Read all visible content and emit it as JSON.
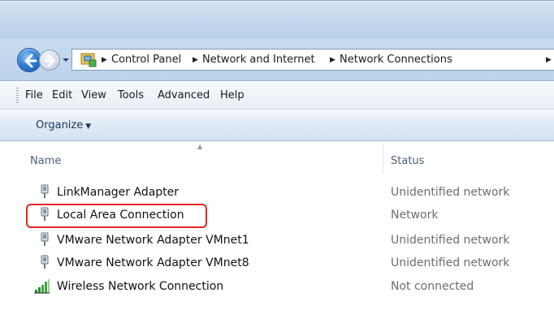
{
  "address_bar": {
    "breadcrumbs": [
      "Control Panel",
      "Network and Internet",
      "Network Connections"
    ]
  },
  "menu": {
    "items": [
      "File",
      "Edit",
      "View",
      "Tools",
      "Advanced",
      "Help"
    ]
  },
  "command_bar": {
    "organize_label": "Organize"
  },
  "columns": {
    "name": "Name",
    "status": "Status"
  },
  "connections": [
    {
      "name": "LinkManager Adapter",
      "status": "Unidentified network",
      "icon": "network-adapter-icon"
    },
    {
      "name": "Local Area Connection",
      "status": "Network",
      "icon": "network-adapter-icon",
      "highlighted": true
    },
    {
      "name": "VMware Network Adapter VMnet1",
      "status": "Unidentified network",
      "icon": "network-adapter-icon"
    },
    {
      "name": "VMware Network Adapter VMnet8",
      "status": "Unidentified network",
      "icon": "network-adapter-icon"
    },
    {
      "name": "Wireless Network Connection",
      "status": "Not connected",
      "icon": "wireless-signal-icon"
    }
  ],
  "colors": {
    "highlight_border": "#e32424",
    "status_text": "#6d6d6d"
  }
}
